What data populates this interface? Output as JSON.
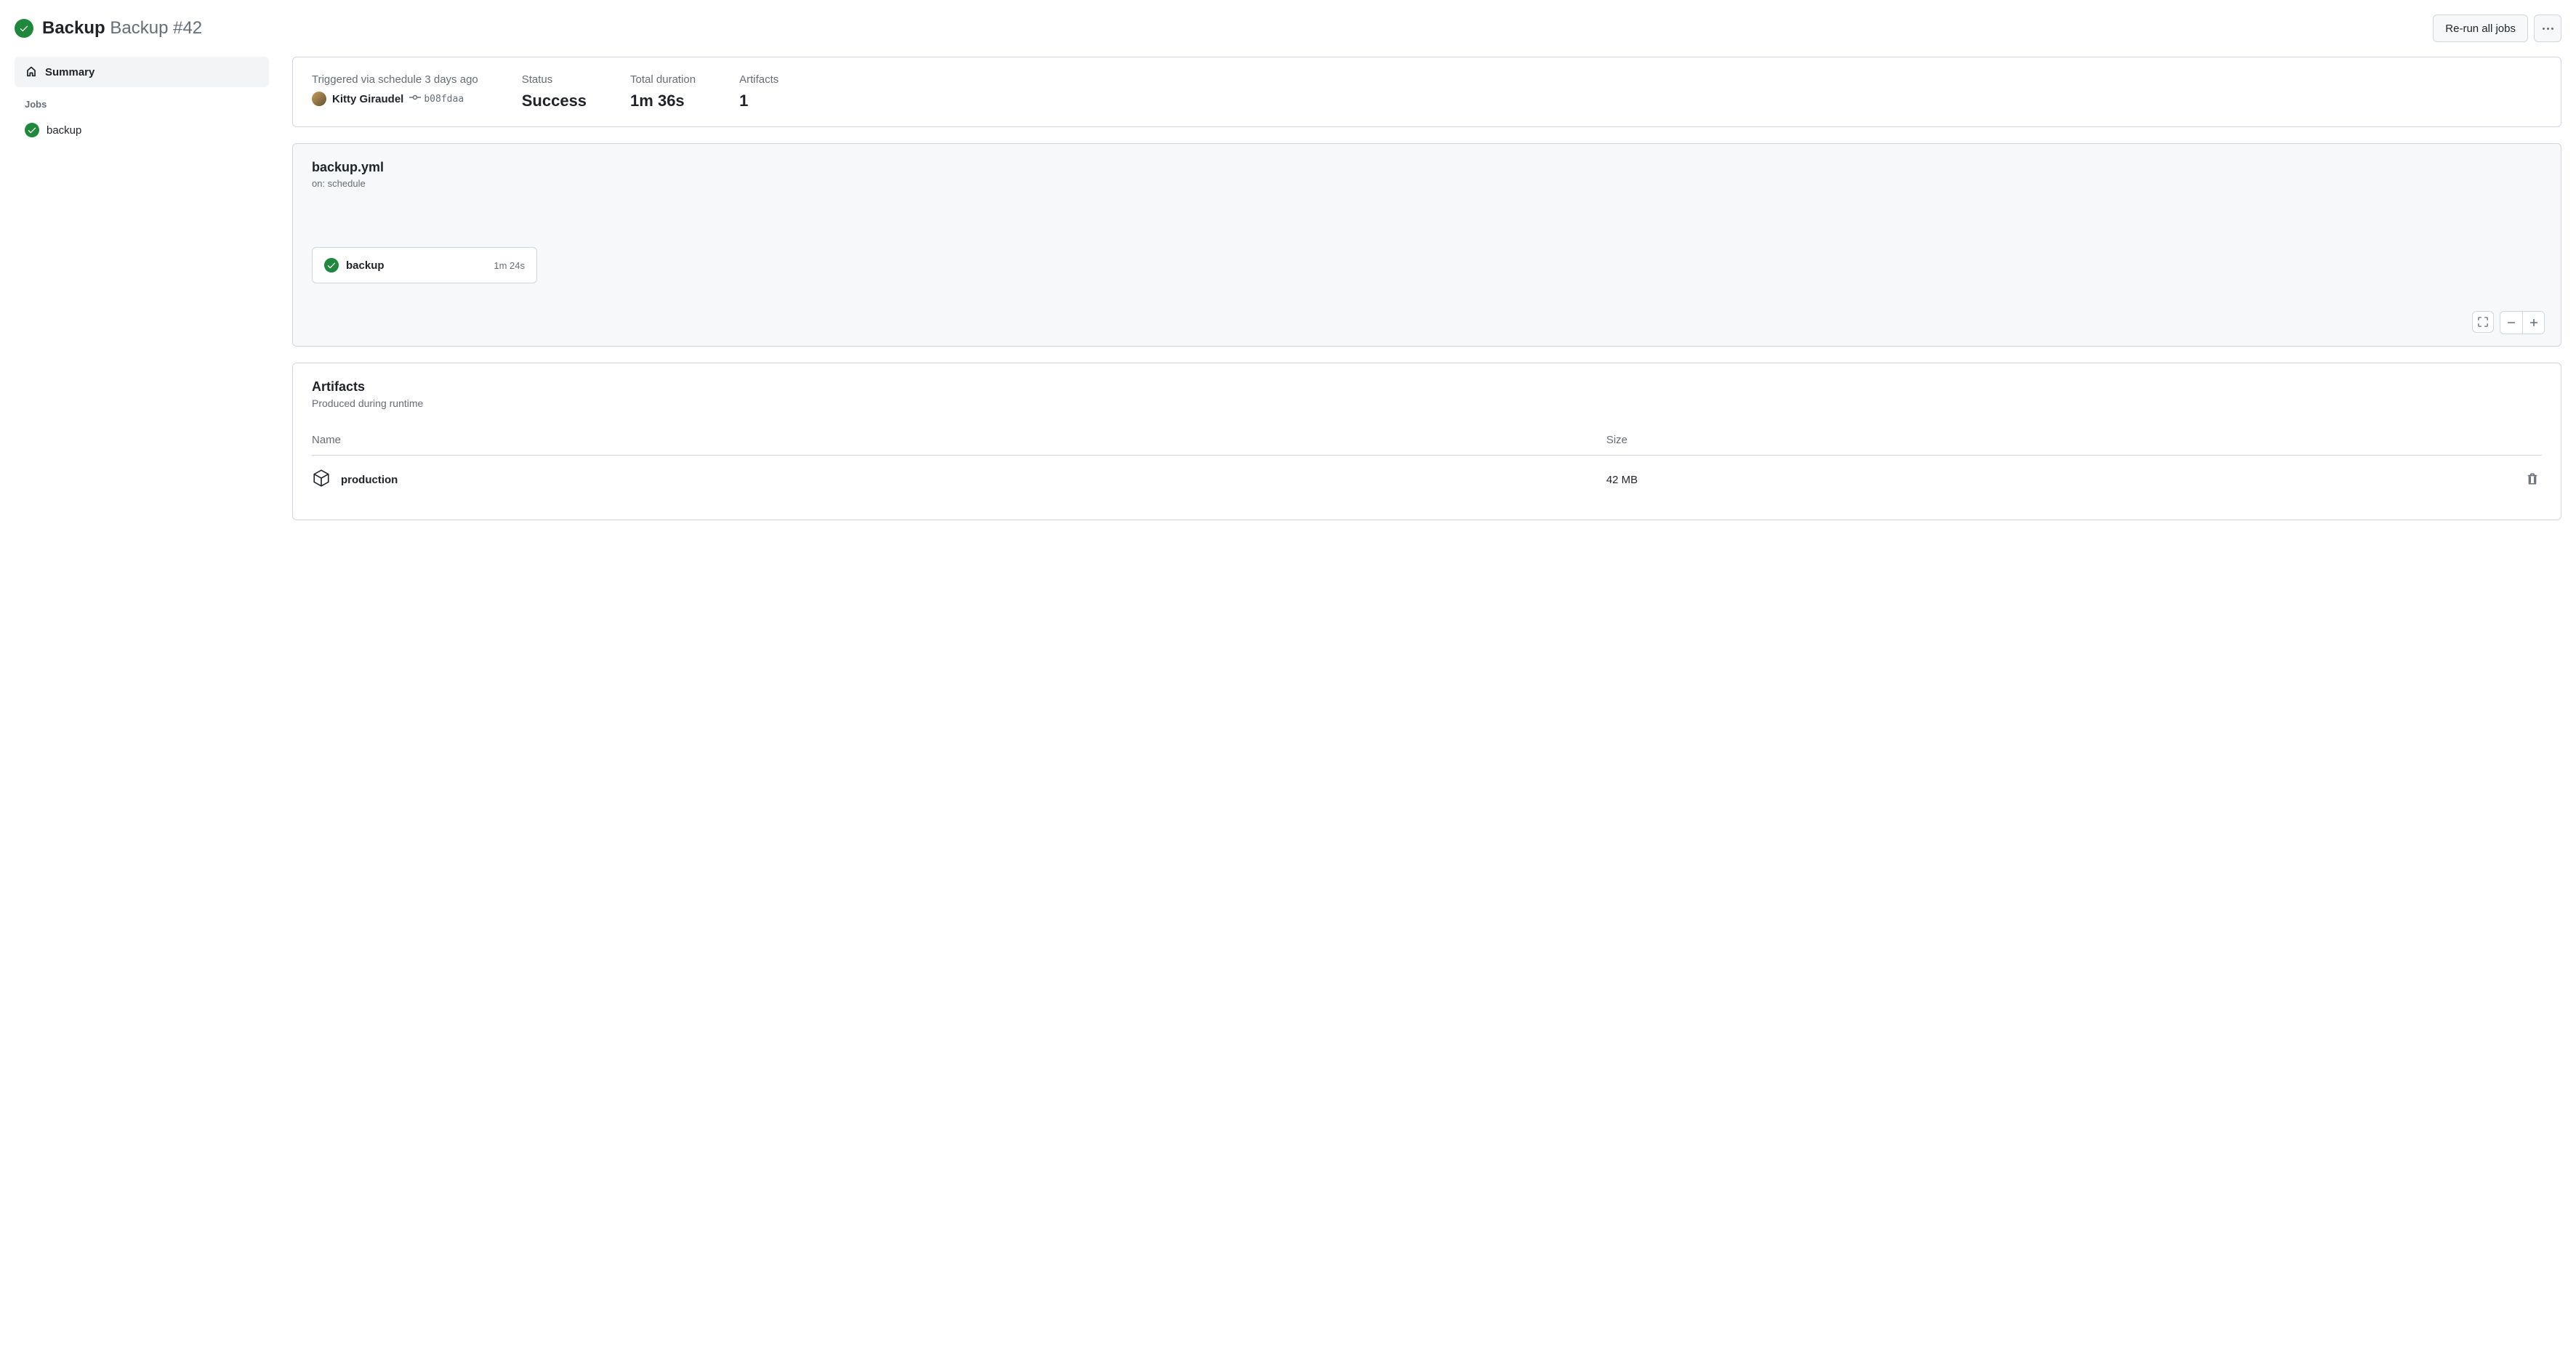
{
  "header": {
    "title_bold": "Backup",
    "title_run": "Backup #42",
    "rerun_label": "Re-run all jobs"
  },
  "sidebar": {
    "summary_label": "Summary",
    "jobs_heading": "Jobs",
    "jobs": [
      {
        "name": "backup"
      }
    ]
  },
  "meta": {
    "triggered_text": "Triggered via schedule 3 days ago",
    "author": "Kitty Giraudel",
    "commit": "b08fdaa",
    "status_label": "Status",
    "status_value": "Success",
    "duration_label": "Total duration",
    "duration_value": "1m 36s",
    "artifacts_label": "Artifacts",
    "artifacts_value": "1"
  },
  "workflow": {
    "file": "backup.yml",
    "trigger_line": "on: schedule",
    "job": {
      "name": "backup",
      "duration": "1m 24s"
    }
  },
  "artifacts": {
    "title": "Artifacts",
    "subtitle": "Produced during runtime",
    "columns": {
      "name": "Name",
      "size": "Size"
    },
    "rows": [
      {
        "name": "production",
        "size": "42 MB"
      }
    ]
  }
}
